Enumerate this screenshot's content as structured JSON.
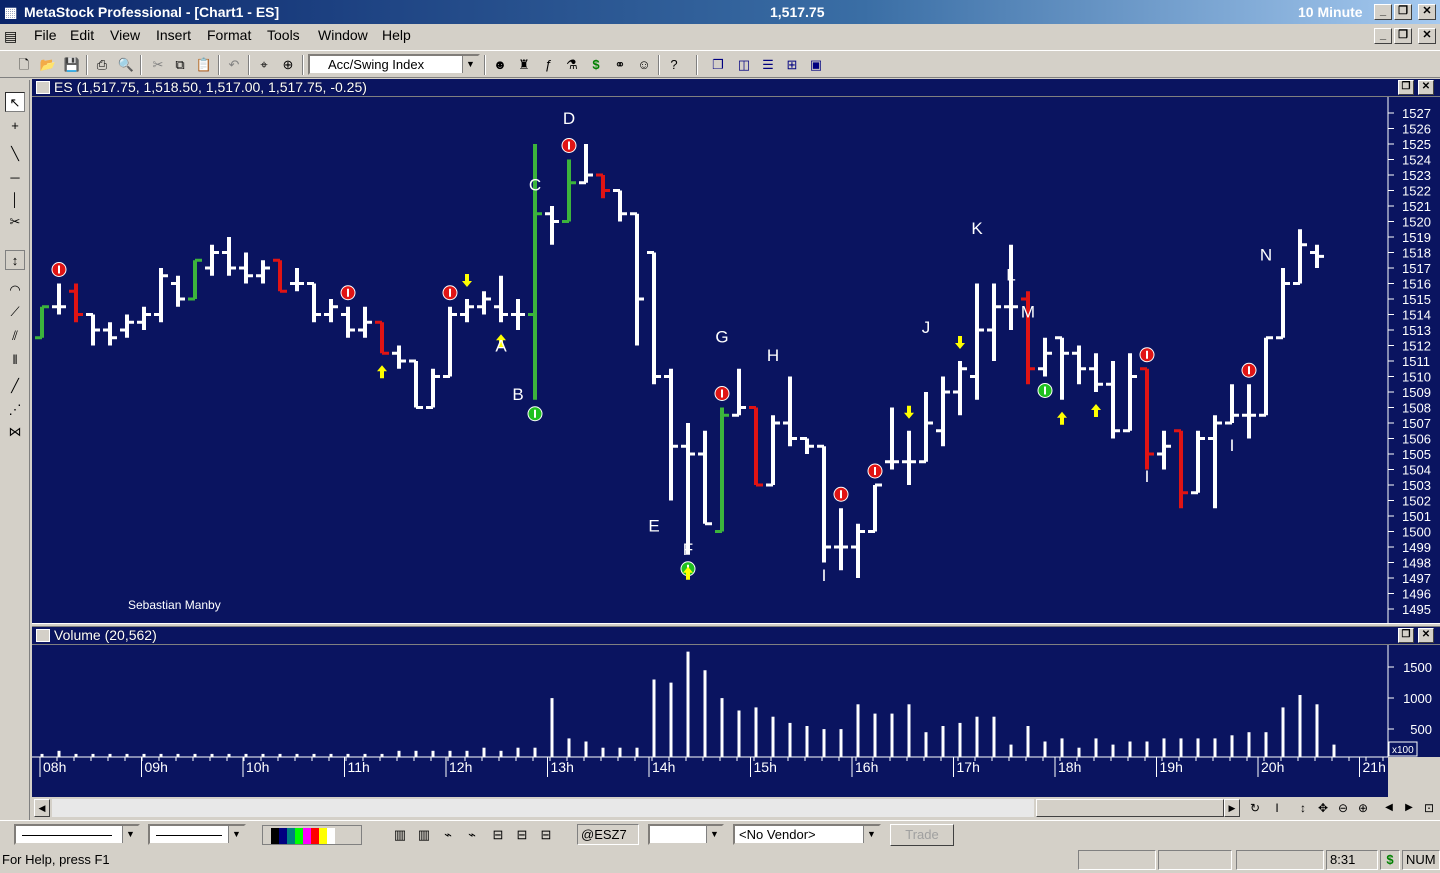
{
  "app": {
    "title": "MetaStock Professional - [Chart1 - ES]",
    "last_price": "1,517.75",
    "interval": "10 Minute"
  },
  "menu": [
    "File",
    "Edit",
    "View",
    "Insert",
    "Format",
    "Tools",
    "Window",
    "Help"
  ],
  "toolbar": {
    "indicator_combo": "Acc/Swing Index"
  },
  "price_pane": {
    "header": "ES (1,517.75, 1,518.50, 1,517.00, 1,517.75, -0.25)",
    "watermark": "Sebastian Manby",
    "y_ticks": [
      1527,
      1526,
      1525,
      1524,
      1523,
      1522,
      1521,
      1520,
      1519,
      1518,
      1517,
      1516,
      1515,
      1514,
      1513,
      1512,
      1511,
      1510,
      1509,
      1508,
      1507,
      1506,
      1505,
      1504,
      1503,
      1502,
      1501,
      1500,
      1499,
      1498,
      1497,
      1496,
      1495
    ],
    "wave_labels": [
      {
        "text": "D",
        "bar": 31,
        "price": 1526.3
      },
      {
        "text": "C",
        "bar": 29,
        "price": 1522.0
      },
      {
        "text": "B",
        "bar": 28,
        "price": 1508.5
      },
      {
        "text": "A",
        "bar": 27,
        "price": 1511.6
      },
      {
        "text": "E",
        "bar": 36,
        "price": 1500.0
      },
      {
        "text": "F",
        "bar": 38,
        "price": 1498.5
      },
      {
        "text": "G",
        "bar": 40,
        "price": 1512.2
      },
      {
        "text": "H",
        "bar": 43,
        "price": 1511.0
      },
      {
        "text": "I",
        "bar": 46,
        "price": 1496.8
      },
      {
        "text": "J",
        "bar": 52,
        "price": 1512.8
      },
      {
        "text": "K",
        "bar": 55,
        "price": 1519.2
      },
      {
        "text": "L",
        "bar": 57,
        "price": 1516.2
      },
      {
        "text": "M",
        "bar": 58,
        "price": 1513.8
      },
      {
        "text": "I",
        "bar": 65,
        "price": 1503.2
      },
      {
        "text": "I",
        "bar": 70,
        "price": 1505.2
      },
      {
        "text": "N",
        "bar": 72,
        "price": 1517.5
      }
    ]
  },
  "volume_pane": {
    "header": "Volume (20,562)",
    "y_ticks": [
      "1500",
      "1000",
      "500"
    ],
    "multiplier": "x100"
  },
  "x_axis": [
    "08h",
    "09h",
    "10h",
    "11h",
    "12h",
    "13h",
    "14h",
    "15h",
    "16h",
    "17h",
    "18h",
    "19h",
    "20h",
    "21h"
  ],
  "bottom": {
    "symbol": "@ESZ7",
    "vendor": "<No Vendor>",
    "trade_label": "Trade"
  },
  "status": {
    "help": "For Help, press F1",
    "time": "8:31",
    "dollar": "$",
    "num": "NUM"
  },
  "colors": {
    "chart_bg": "#0a1460",
    "bar_white": "#ffffff",
    "bar_green": "#3cb43c",
    "bar_red": "#e01414",
    "signal_red": "#e01414",
    "signal_green": "#20c020",
    "arrow_yellow": "#ffff00"
  },
  "chart_data": {
    "type": "ohlc",
    "bars": [
      {
        "o": 1512.5,
        "h": 1514.5,
        "l": 1512.5,
        "c": 1514.5,
        "col": "g"
      },
      {
        "o": 1514.5,
        "h": 1516.0,
        "l": 1514.0,
        "c": 1514.5,
        "col": "w"
      },
      {
        "o": 1515.5,
        "h": 1516.0,
        "l": 1513.5,
        "c": 1514.0,
        "col": "r"
      },
      {
        "o": 1514.0,
        "h": 1514.0,
        "l": 1512.0,
        "c": 1513.0,
        "col": "w"
      },
      {
        "o": 1513.0,
        "h": 1513.5,
        "l": 1512.0,
        "c": 1512.5,
        "col": "w"
      },
      {
        "o": 1513.0,
        "h": 1514.0,
        "l": 1512.5,
        "c": 1513.5,
        "col": "w"
      },
      {
        "o": 1513.5,
        "h": 1514.5,
        "l": 1513.0,
        "c": 1514.0,
        "col": "w"
      },
      {
        "o": 1514.0,
        "h": 1517.0,
        "l": 1513.5,
        "c": 1516.5,
        "col": "w"
      },
      {
        "o": 1516.0,
        "h": 1516.5,
        "l": 1514.5,
        "c": 1515.0,
        "col": "w"
      },
      {
        "o": 1515.0,
        "h": 1517.5,
        "l": 1515.0,
        "c": 1517.5,
        "col": "g"
      },
      {
        "o": 1517.0,
        "h": 1518.5,
        "l": 1516.5,
        "c": 1518.0,
        "col": "w"
      },
      {
        "o": 1518.0,
        "h": 1519.0,
        "l": 1516.5,
        "c": 1517.0,
        "col": "w"
      },
      {
        "o": 1517.0,
        "h": 1518.0,
        "l": 1516.0,
        "c": 1516.5,
        "col": "w"
      },
      {
        "o": 1516.5,
        "h": 1517.5,
        "l": 1516.0,
        "c": 1517.0,
        "col": "w"
      },
      {
        "o": 1517.5,
        "h": 1517.5,
        "l": 1515.5,
        "c": 1515.5,
        "col": "r"
      },
      {
        "o": 1516.0,
        "h": 1517.0,
        "l": 1515.5,
        "c": 1516.0,
        "col": "w"
      },
      {
        "o": 1516.0,
        "h": 1516.0,
        "l": 1513.5,
        "c": 1514.0,
        "col": "w"
      },
      {
        "o": 1514.0,
        "h": 1515.0,
        "l": 1513.5,
        "c": 1514.5,
        "col": "w"
      },
      {
        "o": 1514.0,
        "h": 1514.5,
        "l": 1512.5,
        "c": 1513.0,
        "col": "w"
      },
      {
        "o": 1513.0,
        "h": 1514.5,
        "l": 1512.5,
        "c": 1513.5,
        "col": "w"
      },
      {
        "o": 1513.5,
        "h": 1513.5,
        "l": 1511.5,
        "c": 1511.5,
        "col": "r"
      },
      {
        "o": 1511.5,
        "h": 1512.0,
        "l": 1510.5,
        "c": 1511.0,
        "col": "w"
      },
      {
        "o": 1511.0,
        "h": 1511.0,
        "l": 1508.0,
        "c": 1508.0,
        "col": "w"
      },
      {
        "o": 1508.0,
        "h": 1510.5,
        "l": 1508.0,
        "c": 1510.0,
        "col": "w"
      },
      {
        "o": 1510.0,
        "h": 1514.5,
        "l": 1510.0,
        "c": 1514.0,
        "col": "w"
      },
      {
        "o": 1514.0,
        "h": 1515.0,
        "l": 1513.5,
        "c": 1514.5,
        "col": "w"
      },
      {
        "o": 1514.5,
        "h": 1515.5,
        "l": 1514.0,
        "c": 1515.0,
        "col": "w"
      },
      {
        "o": 1514.5,
        "h": 1516.5,
        "l": 1513.5,
        "c": 1514.0,
        "col": "w"
      },
      {
        "o": 1514.0,
        "h": 1515.0,
        "l": 1513.0,
        "c": 1514.0,
        "col": "w"
      },
      {
        "o": 1514.0,
        "h": 1525.0,
        "l": 1508.5,
        "c": 1520.5,
        "col": "g"
      },
      {
        "o": 1520.5,
        "h": 1521.0,
        "l": 1518.5,
        "c": 1520.0,
        "col": "w"
      },
      {
        "o": 1520.0,
        "h": 1524.0,
        "l": 1520.0,
        "c": 1522.5,
        "col": "g"
      },
      {
        "o": 1522.5,
        "h": 1525.0,
        "l": 1522.5,
        "c": 1523.0,
        "col": "w"
      },
      {
        "o": 1523.0,
        "h": 1523.0,
        "l": 1521.5,
        "c": 1522.0,
        "col": "r"
      },
      {
        "o": 1522.0,
        "h": 1522.0,
        "l": 1520.0,
        "c": 1520.5,
        "col": "w"
      },
      {
        "o": 1520.5,
        "h": 1520.5,
        "l": 1512.0,
        "c": 1515.0,
        "col": "w"
      },
      {
        "o": 1518.0,
        "h": 1518.0,
        "l": 1509.5,
        "c": 1510.0,
        "col": "w"
      },
      {
        "o": 1510.0,
        "h": 1510.5,
        "l": 1502.0,
        "c": 1505.5,
        "col": "w"
      },
      {
        "o": 1505.5,
        "h": 1507.0,
        "l": 1498.5,
        "c": 1505.0,
        "col": "w"
      },
      {
        "o": 1505.0,
        "h": 1506.5,
        "l": 1500.5,
        "c": 1500.5,
        "col": "w"
      },
      {
        "o": 1500.0,
        "h": 1508.0,
        "l": 1500.0,
        "c": 1507.5,
        "col": "g"
      },
      {
        "o": 1507.5,
        "h": 1510.5,
        "l": 1507.5,
        "c": 1508.0,
        "col": "w"
      },
      {
        "o": 1508.0,
        "h": 1508.0,
        "l": 1503.0,
        "c": 1503.0,
        "col": "r"
      },
      {
        "o": 1503.0,
        "h": 1507.5,
        "l": 1503.0,
        "c": 1507.0,
        "col": "w"
      },
      {
        "o": 1507.0,
        "h": 1510.0,
        "l": 1505.5,
        "c": 1506.0,
        "col": "w"
      },
      {
        "o": 1506.0,
        "h": 1506.0,
        "l": 1505.0,
        "c": 1505.5,
        "col": "w"
      },
      {
        "o": 1505.5,
        "h": 1505.5,
        "l": 1498.0,
        "c": 1499.0,
        "col": "w"
      },
      {
        "o": 1499.0,
        "h": 1501.5,
        "l": 1497.5,
        "c": 1499.0,
        "col": "w"
      },
      {
        "o": 1499.0,
        "h": 1500.5,
        "l": 1497.0,
        "c": 1500.0,
        "col": "w"
      },
      {
        "o": 1500.0,
        "h": 1503.0,
        "l": 1500.0,
        "c": 1503.0,
        "col": "w"
      },
      {
        "o": 1504.5,
        "h": 1508.0,
        "l": 1504.0,
        "c": 1504.5,
        "col": "w"
      },
      {
        "o": 1504.5,
        "h": 1506.5,
        "l": 1503.0,
        "c": 1504.5,
        "col": "w"
      },
      {
        "o": 1504.5,
        "h": 1509.0,
        "l": 1504.5,
        "c": 1507.0,
        "col": "w"
      },
      {
        "o": 1506.5,
        "h": 1510.0,
        "l": 1505.5,
        "c": 1509.0,
        "col": "w"
      },
      {
        "o": 1509.0,
        "h": 1511.0,
        "l": 1507.5,
        "c": 1510.5,
        "col": "w"
      },
      {
        "o": 1510.0,
        "h": 1516.0,
        "l": 1508.5,
        "c": 1513.0,
        "col": "w"
      },
      {
        "o": 1513.0,
        "h": 1516.0,
        "l": 1511.0,
        "c": 1514.5,
        "col": "w"
      },
      {
        "o": 1514.5,
        "h": 1518.5,
        "l": 1513.0,
        "c": 1514.5,
        "col": "w"
      },
      {
        "o": 1515.0,
        "h": 1515.5,
        "l": 1509.5,
        "c": 1510.5,
        "col": "r"
      },
      {
        "o": 1510.5,
        "h": 1512.5,
        "l": 1510.0,
        "c": 1511.5,
        "col": "w"
      },
      {
        "o": 1512.5,
        "h": 1512.5,
        "l": 1508.5,
        "c": 1511.5,
        "col": "w"
      },
      {
        "o": 1511.5,
        "h": 1512.0,
        "l": 1509.5,
        "c": 1510.5,
        "col": "w"
      },
      {
        "o": 1510.5,
        "h": 1511.5,
        "l": 1509.0,
        "c": 1509.5,
        "col": "w"
      },
      {
        "o": 1509.5,
        "h": 1511.0,
        "l": 1506.0,
        "c": 1506.5,
        "col": "w"
      },
      {
        "o": 1506.5,
        "h": 1511.5,
        "l": 1506.5,
        "c": 1510.0,
        "col": "w"
      },
      {
        "o": 1510.5,
        "h": 1510.5,
        "l": 1504.0,
        "c": 1505.0,
        "col": "r"
      },
      {
        "o": 1505.0,
        "h": 1506.5,
        "l": 1504.0,
        "c": 1505.5,
        "col": "w"
      },
      {
        "o": 1506.5,
        "h": 1506.5,
        "l": 1501.5,
        "c": 1502.5,
        "col": "r"
      },
      {
        "o": 1502.5,
        "h": 1506.5,
        "l": 1502.5,
        "c": 1506.0,
        "col": "w"
      },
      {
        "o": 1506.0,
        "h": 1507.5,
        "l": 1501.5,
        "c": 1507.0,
        "col": "w"
      },
      {
        "o": 1507.0,
        "h": 1509.5,
        "l": 1507.0,
        "c": 1507.5,
        "col": "w"
      },
      {
        "o": 1507.5,
        "h": 1509.5,
        "l": 1506.0,
        "c": 1507.5,
        "col": "w"
      },
      {
        "o": 1507.5,
        "h": 1512.5,
        "l": 1507.5,
        "c": 1512.5,
        "col": "w"
      },
      {
        "o": 1512.5,
        "h": 1517.0,
        "l": 1512.5,
        "c": 1516.0,
        "col": "w"
      },
      {
        "o": 1516.0,
        "h": 1519.5,
        "l": 1516.0,
        "c": 1518.5,
        "col": "w"
      },
      {
        "o": 1518.0,
        "h": 1518.5,
        "l": 1517.0,
        "c": 1517.75,
        "col": "w"
      }
    ],
    "volume": [
      1,
      2,
      1,
      1,
      1,
      1,
      1,
      1,
      1,
      1,
      1,
      1,
      1,
      1,
      1,
      1,
      1,
      1,
      1,
      1,
      1,
      2,
      2,
      2,
      2,
      2,
      3,
      2,
      3,
      3,
      19,
      6,
      5,
      3,
      3,
      3,
      25,
      24,
      34,
      28,
      19,
      15,
      16,
      13,
      11,
      10,
      9,
      9,
      17,
      14,
      14,
      17,
      8,
      10,
      11,
      13,
      13,
      4,
      10,
      5,
      6,
      3,
      6,
      4,
      5,
      5,
      6,
      6,
      6,
      6,
      7,
      8,
      8,
      16,
      20,
      17,
      4
    ],
    "signals": [
      {
        "bar": 1,
        "type": "red"
      },
      {
        "bar": 18,
        "type": "red"
      },
      {
        "bar": 24,
        "type": "red"
      },
      {
        "bar": 29,
        "type": "green"
      },
      {
        "bar": 31,
        "type": "red"
      },
      {
        "bar": 38,
        "type": "green"
      },
      {
        "bar": 40,
        "type": "red"
      },
      {
        "bar": 47,
        "type": "red"
      },
      {
        "bar": 49,
        "type": "red"
      },
      {
        "bar": 59,
        "type": "green"
      },
      {
        "bar": 65,
        "type": "red"
      },
      {
        "bar": 71,
        "type": "red"
      }
    ],
    "arrows": [
      {
        "bar": 20,
        "dir": "up"
      },
      {
        "bar": 25,
        "dir": "down"
      },
      {
        "bar": 27,
        "dir": "up"
      },
      {
        "bar": 38,
        "dir": "up"
      },
      {
        "bar": 51,
        "dir": "down"
      },
      {
        "bar": 54,
        "dir": "down"
      },
      {
        "bar": 60,
        "dir": "up"
      },
      {
        "bar": 62,
        "dir": "up"
      }
    ]
  }
}
